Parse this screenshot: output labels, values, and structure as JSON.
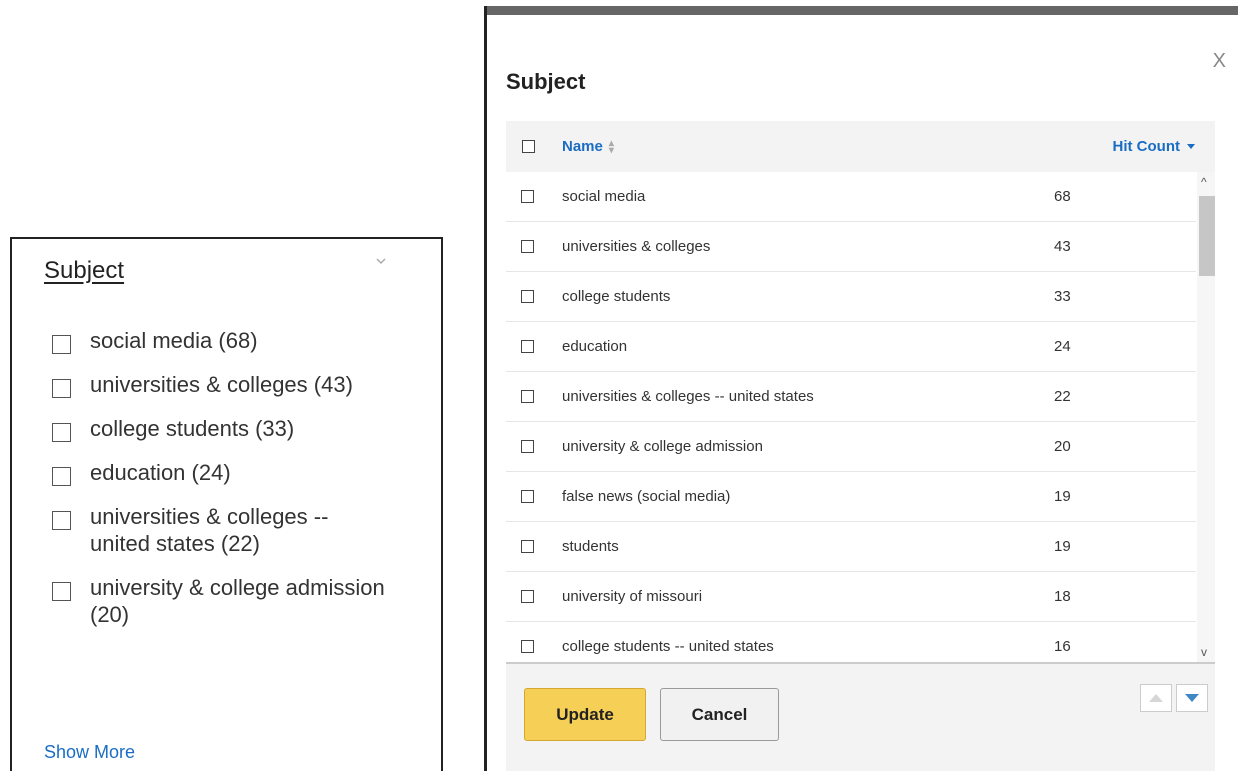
{
  "facet": {
    "title": "Subject",
    "items": [
      {
        "label": "social media (68)"
      },
      {
        "label": "universities & colleges (43)"
      },
      {
        "label": "college students (33)"
      },
      {
        "label": "education (24)"
      },
      {
        "label": "universities & colleges -- united states (22)"
      },
      {
        "label": "university & college admission (20)"
      }
    ],
    "show_more": "Show More"
  },
  "modal": {
    "title": "Subject",
    "close": "X",
    "columns": {
      "name": "Name",
      "hit_count": "Hit Count"
    },
    "rows": [
      {
        "name": "social media",
        "count": "68"
      },
      {
        "name": "universities & colleges",
        "count": "43"
      },
      {
        "name": "college students",
        "count": "33"
      },
      {
        "name": "education",
        "count": "24"
      },
      {
        "name": "universities & colleges -- united states",
        "count": "22"
      },
      {
        "name": "university & college admission",
        "count": "20"
      },
      {
        "name": "false news (social media)",
        "count": "19"
      },
      {
        "name": "students",
        "count": "19"
      },
      {
        "name": "university of missouri",
        "count": "18"
      },
      {
        "name": "college students -- united states",
        "count": "16"
      }
    ],
    "buttons": {
      "update": "Update",
      "cancel": "Cancel"
    }
  },
  "colors": {
    "link": "#1a6dc3",
    "update_button": "#f6cf57",
    "page_down_arrow": "#3f87c5"
  }
}
